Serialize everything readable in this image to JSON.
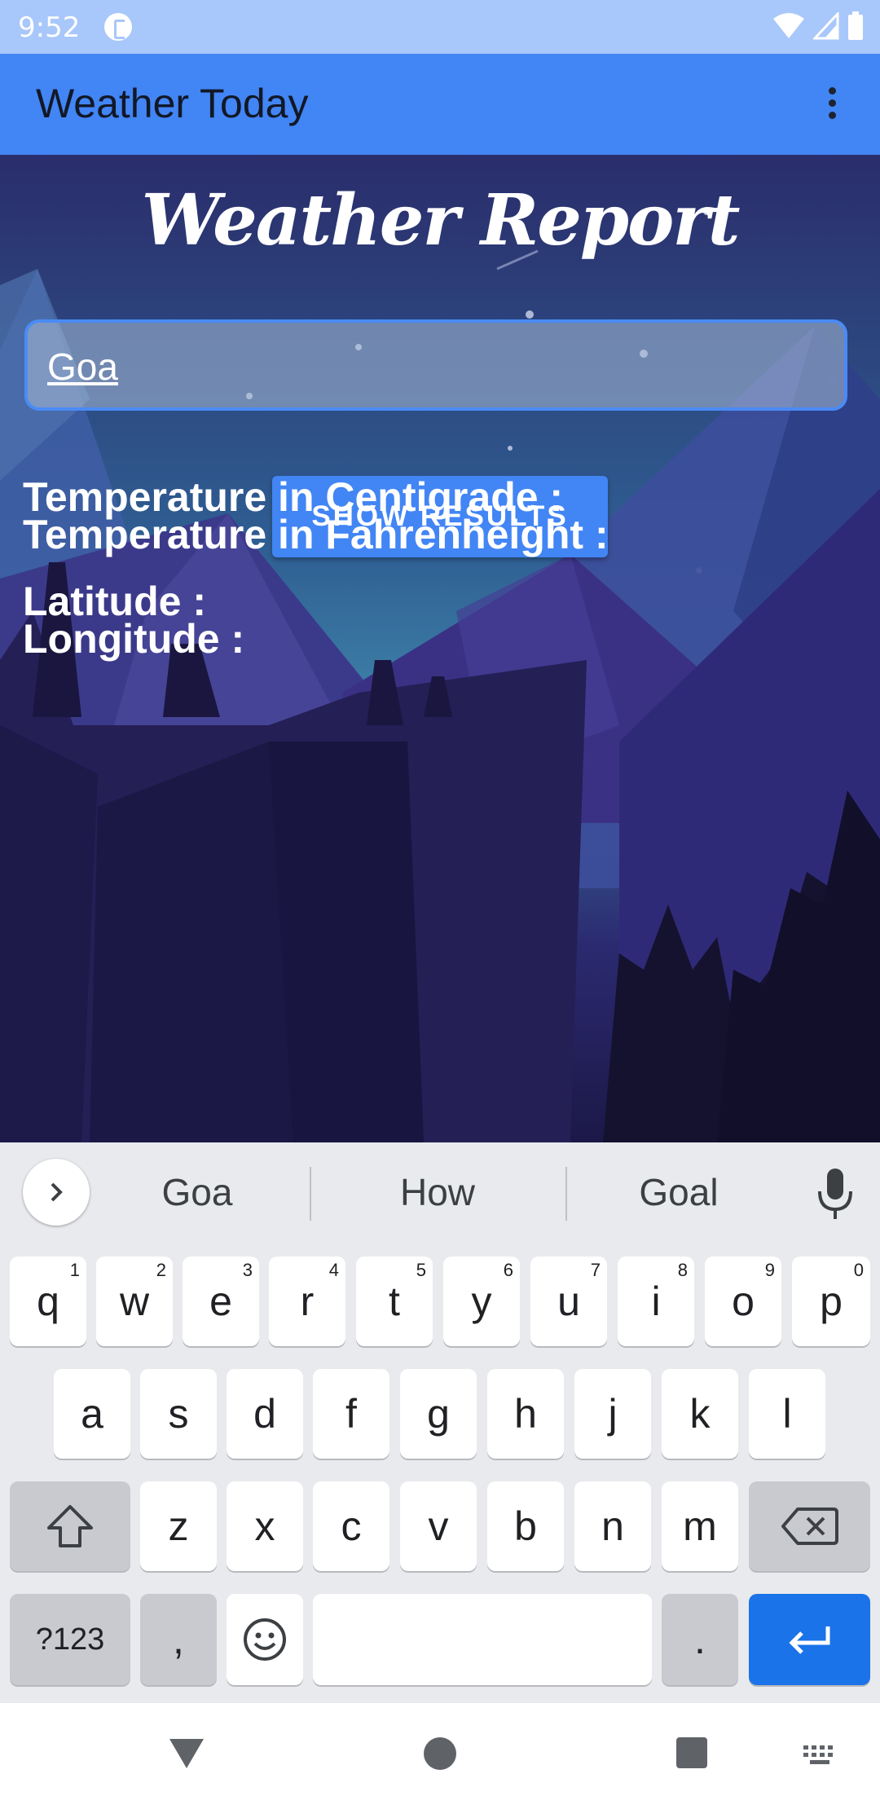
{
  "status_bar": {
    "time": "9:52"
  },
  "app_bar": {
    "title": "Weather Today"
  },
  "report": {
    "heading": "Weather Report"
  },
  "search": {
    "value": "Goa",
    "placeholder": ""
  },
  "show_button": {
    "label": "SHOW RESULTS"
  },
  "info": {
    "temp_c": "Temperature in Centigrade :",
    "temp_f": "Temperature in Fahrenheight :",
    "latitude": "Latitude :",
    "longitude": "Longitude :"
  },
  "keyboard": {
    "suggestions": [
      "Goa",
      "How",
      "Goal"
    ],
    "row1": [
      {
        "k": "q",
        "n": "1"
      },
      {
        "k": "w",
        "n": "2"
      },
      {
        "k": "e",
        "n": "3"
      },
      {
        "k": "r",
        "n": "4"
      },
      {
        "k": "t",
        "n": "5"
      },
      {
        "k": "y",
        "n": "6"
      },
      {
        "k": "u",
        "n": "7"
      },
      {
        "k": "i",
        "n": "8"
      },
      {
        "k": "o",
        "n": "9"
      },
      {
        "k": "p",
        "n": "0"
      }
    ],
    "row2": [
      "a",
      "s",
      "d",
      "f",
      "g",
      "h",
      "j",
      "k",
      "l"
    ],
    "row3": [
      "z",
      "x",
      "c",
      "v",
      "b",
      "n",
      "m"
    ],
    "sym_label": "?123",
    "comma": ",",
    "period": "."
  },
  "colors": {
    "accent": "#4285f4",
    "enter": "#1a73e8",
    "status": "#a8c7fa"
  }
}
